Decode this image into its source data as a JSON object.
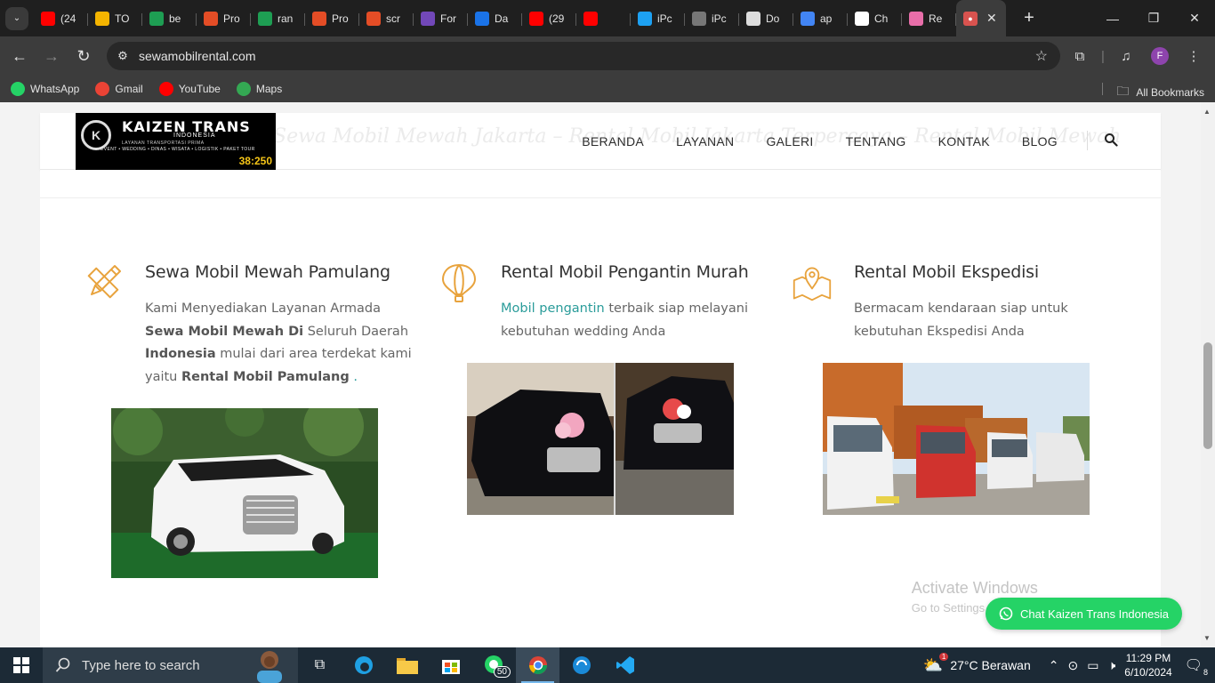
{
  "browser": {
    "tabs": [
      {
        "title": "(24",
        "icon": "youtube-icon",
        "color": "#ff0000"
      },
      {
        "title": "TO",
        "icon": "google-drive-icon",
        "color": "#f4b400"
      },
      {
        "title": "be",
        "icon": "sheets-icon",
        "color": "#1e9e53"
      },
      {
        "title": "Pro",
        "icon": "project-icon",
        "color": "#e44d26"
      },
      {
        "title": "ran",
        "icon": "sheets-icon",
        "color": "#1e9e53"
      },
      {
        "title": "Pro",
        "icon": "project-icon",
        "color": "#e44d26"
      },
      {
        "title": "scr",
        "icon": "script-icon",
        "color": "#e44d26"
      },
      {
        "title": "For",
        "icon": "forms-icon",
        "color": "#7248b9"
      },
      {
        "title": "Da",
        "icon": "data-icon",
        "color": "#1a73e8"
      },
      {
        "title": "(29",
        "icon": "youtube-icon",
        "color": "#ff0000"
      },
      {
        "title": "",
        "icon": "youtube-audio-icon",
        "color": "#ff0000"
      },
      {
        "title": "iPc",
        "icon": "ipc-icon",
        "color": "#1da1f2"
      },
      {
        "title": "iPc",
        "icon": "globe-icon",
        "color": "#777777"
      },
      {
        "title": "Do",
        "icon": "download-icon",
        "color": "#dddddd"
      },
      {
        "title": "ap",
        "icon": "google-icon",
        "color": "#4285f4"
      },
      {
        "title": "Ch",
        "icon": "chatgpt-icon",
        "color": "#ffffff"
      },
      {
        "title": "Re",
        "icon": "flower-icon",
        "color": "#e86ea9"
      }
    ],
    "active_tab": {
      "icon": "site-icon",
      "color": "#d9534f"
    },
    "url": "sewamobilrental.com",
    "bookmarks": [
      {
        "label": "WhatsApp",
        "icon": "whatsapp-icon",
        "color": "#25d366"
      },
      {
        "label": "Gmail",
        "icon": "gmail-icon",
        "color": "#ea4335"
      },
      {
        "label": "YouTube",
        "icon": "youtube-icon",
        "color": "#ff0000"
      },
      {
        "label": "Maps",
        "icon": "maps-icon",
        "color": "#34a853"
      }
    ],
    "all_bookmarks": "All Bookmarks",
    "profile_initial": "F"
  },
  "site": {
    "logo": {
      "name": "KAIZEN TRANS",
      "sub": "INDONESIA",
      "line": "LAYANAN TRANSPORTASI PRIMA",
      "tags": "EVENT • WEDDING • DINAS • WISATA • LOGISTIK • PAKET TOUR",
      "number": "38:250"
    },
    "ghost_title": "Sewa Mobil Mewah Jakarta – Rental Mobil Jakarta Terpercaya – Rental Mobil Mewah",
    "nav": [
      "BERANDA",
      "LAYANAN",
      "GALERI",
      "TENTANG",
      "KONTAK",
      "BLOG"
    ],
    "features": [
      {
        "title": "Sewa Mobil Mewah Pamulang",
        "icon": "pencil-ruler-icon",
        "text_parts": [
          "Kami Menyediakan Layanan Armada ",
          "Sewa Mobil Mewah Di",
          " Seluruh Daerah ",
          "Indonesia",
          " mulai dari area terdekat kami yaitu ",
          "Rental Mobil Pamulang",
          " ."
        ]
      },
      {
        "title": "Rental Mobil Pengantin Murah",
        "icon": "hot-air-balloon-icon",
        "link_text": "Mobil pengantin",
        "text": " terbaik siap melayani kebutuhan wedding Anda"
      },
      {
        "title": "Rental Mobil Ekspedisi",
        "icon": "map-pin-icon",
        "text": "Bermacam kendaraan siap untuk kebutuhan Ekspedisi Anda"
      }
    ],
    "accent_color": "#e8a33d",
    "link_color": "#2a9c9a"
  },
  "overlay": {
    "activate_title": "Activate Windows",
    "activate_sub": "Go to Settings to activate Windows.",
    "chat_button": "Chat Kaizen Trans Indonesia"
  },
  "taskbar": {
    "search_placeholder": "Type here to search",
    "whatsapp_badge": "50",
    "weather": "27°C  Berawan",
    "weather_badge": "1",
    "time": "11:29 PM",
    "date": "6/10/2024",
    "notifications": "8"
  }
}
